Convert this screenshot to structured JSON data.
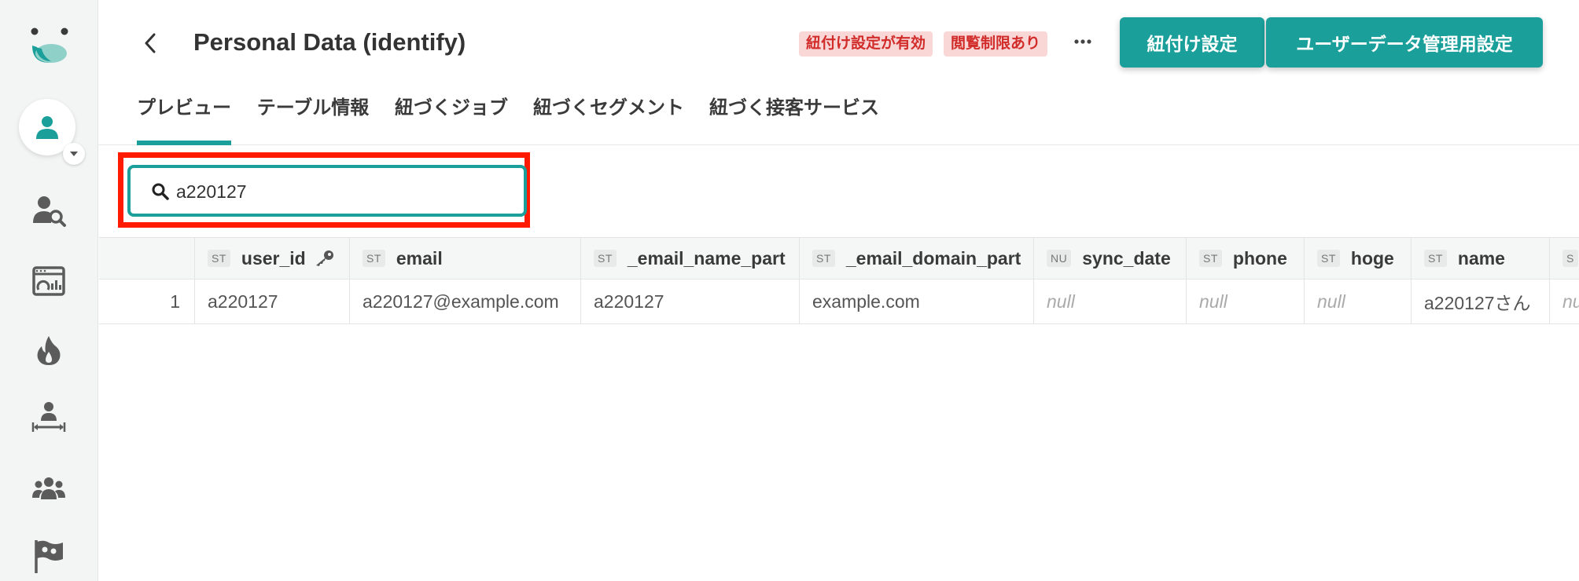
{
  "sidebar": {
    "icons": [
      "app-logo",
      "user-search-icon",
      "dashboard-icon",
      "fire-icon",
      "user-measure-icon",
      "group-icon",
      "flag-icon"
    ]
  },
  "header": {
    "title": "Personal Data (identify)",
    "badges": [
      "紐付け設定が有効",
      "閲覧制限あり"
    ],
    "more_label": "···",
    "buttons": [
      "紐付け設定",
      "ユーザーデータ管理用設定"
    ]
  },
  "tabs": [
    {
      "label": "プレビュー",
      "active": true
    },
    {
      "label": "テーブル情報",
      "active": false
    },
    {
      "label": "紐づくジョブ",
      "active": false
    },
    {
      "label": "紐づくセグメント",
      "active": false
    },
    {
      "label": "紐づく接客サービス",
      "active": false
    }
  ],
  "search": {
    "value": "a220127"
  },
  "table": {
    "columns": [
      {
        "type": "ST",
        "name": "user_id"
      },
      {
        "type": "ST",
        "name": "email"
      },
      {
        "type": "ST",
        "name": "_email_name_part"
      },
      {
        "type": "ST",
        "name": "_email_domain_part"
      },
      {
        "type": "NU",
        "name": "sync_date"
      },
      {
        "type": "ST",
        "name": "phone"
      },
      {
        "type": "ST",
        "name": "hoge"
      },
      {
        "type": "ST",
        "name": "name"
      },
      {
        "type": "S",
        "name": ""
      }
    ],
    "rows": [
      {
        "index": "1",
        "cells": [
          "a220127",
          "a220127@example.com",
          "a220127",
          "example.com",
          "null",
          "null",
          "null",
          "a220127さん",
          "nu"
        ]
      }
    ]
  },
  "colors": {
    "accent": "#1a9f9a",
    "badge_bg": "#f8d7d6",
    "badge_text": "#d12c2a",
    "highlight": "#ff1a00"
  }
}
